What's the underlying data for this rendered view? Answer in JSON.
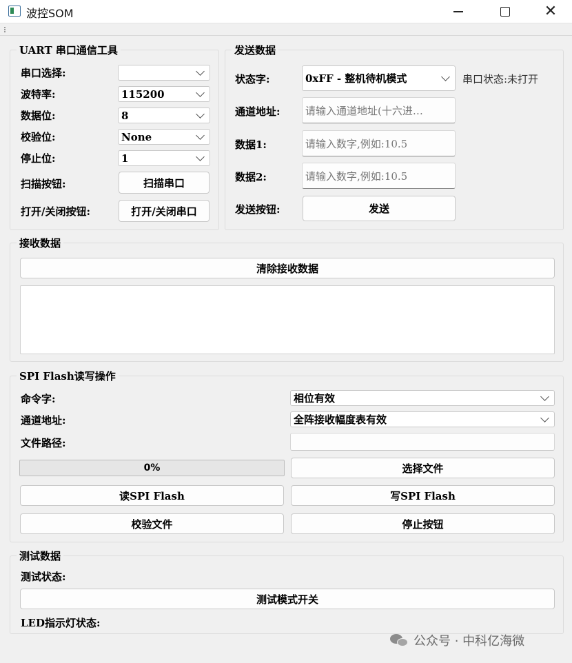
{
  "window": {
    "title": "波控SOM"
  },
  "uart": {
    "title": "UART 串口通信工具",
    "port_label": "串口选择:",
    "port_value": "",
    "baud_label": "波特率:",
    "baud_value": "115200",
    "databits_label": "数据位:",
    "databits_value": "8",
    "parity_label": "校验位:",
    "parity_value": "None",
    "stopbits_label": "停止位:",
    "stopbits_value": "1",
    "scan_label": "扫描按钮:",
    "scan_button": "扫描串口",
    "open_label": "打开/关闭按钮:",
    "open_button": "打开/关闭串口"
  },
  "send": {
    "title": "发送数据",
    "status_word_label": "状态字:",
    "status_word_value": "0xFF - 整机待机模式",
    "port_status": "串口状态:未打开",
    "channel_label": "通道地址:",
    "channel_placeholder": "请输入通道地址(十六进…",
    "data1_label": "数据1:",
    "data1_placeholder": "请输入数字,例如:10.5",
    "data2_label": "数据2:",
    "data2_placeholder": "请输入数字,例如:10.5",
    "send_label": "发送按钮:",
    "send_button": "发送"
  },
  "receive": {
    "title": "接收数据",
    "clear_button": "清除接收数据",
    "content": ""
  },
  "spi": {
    "title": "SPI Flash读写操作",
    "cmd_label": "命令字:",
    "cmd_value": "相位有效",
    "channel_label": "通道地址:",
    "channel_value": "全阵接收幅度表有效",
    "path_label": "文件路径:",
    "path_value": "",
    "progress_text": "0%",
    "progress_value": 0,
    "choose_file_button": "选择文件",
    "read_button": "读SPI Flash",
    "write_button": "写SPI Flash",
    "verify_button": "校验文件",
    "stop_button": "停止按钮"
  },
  "test": {
    "title": "测试数据",
    "status_label": "测试状态:",
    "mode_button": "测试模式开关",
    "led_label": "LED指示灯状态:"
  },
  "watermark": {
    "text": "公众号 · 中科亿海微"
  }
}
